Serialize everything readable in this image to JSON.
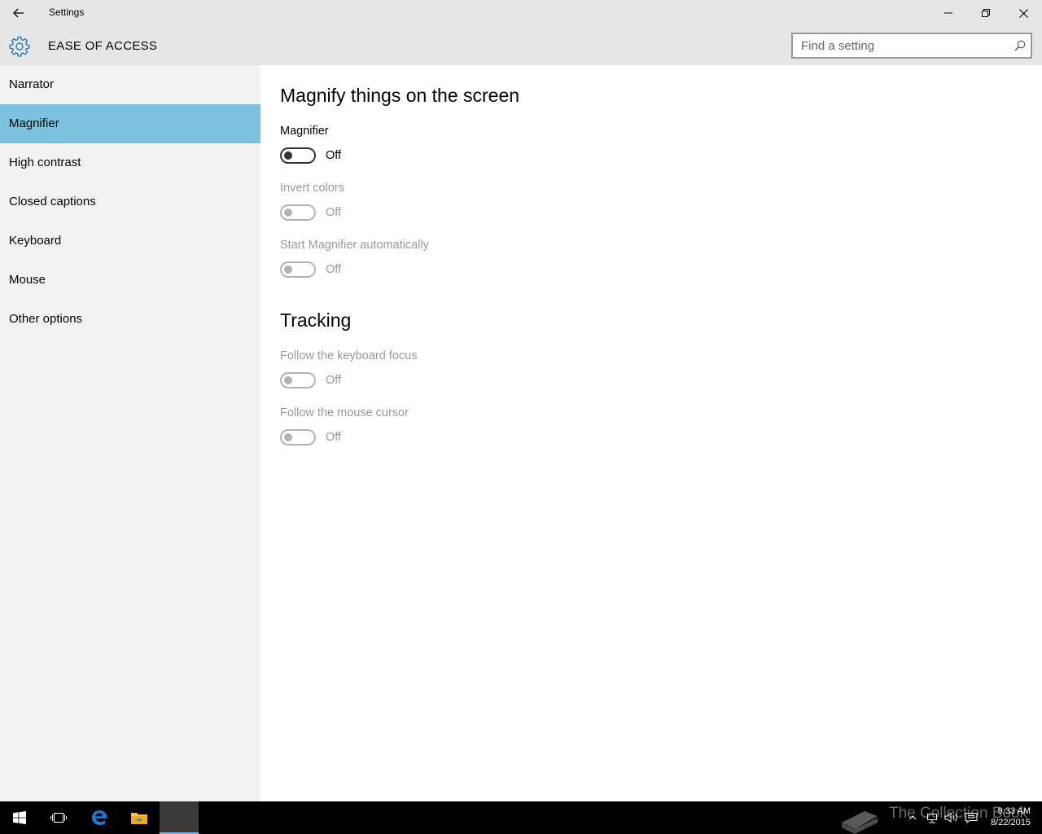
{
  "window": {
    "title": "Settings"
  },
  "header": {
    "section": "EASE OF ACCESS",
    "search_placeholder": "Find a setting"
  },
  "sidebar": {
    "items": [
      {
        "label": "Narrator"
      },
      {
        "label": "Magnifier",
        "active": true
      },
      {
        "label": "High contrast"
      },
      {
        "label": "Closed captions"
      },
      {
        "label": "Keyboard"
      },
      {
        "label": "Mouse"
      },
      {
        "label": "Other options"
      }
    ]
  },
  "main": {
    "heading": "Magnify things on the screen",
    "magnifier": {
      "label": "Magnifier",
      "state": "Off",
      "enabled": true
    },
    "invert": {
      "label": "Invert colors",
      "state": "Off",
      "enabled": false
    },
    "autostart": {
      "label": "Start Magnifier automatically",
      "state": "Off",
      "enabled": false
    },
    "tracking_heading": "Tracking",
    "keyboard_focus": {
      "label": "Follow the keyboard focus",
      "state": "Off",
      "enabled": false
    },
    "mouse_cursor": {
      "label": "Follow the mouse cursor",
      "state": "Off",
      "enabled": false
    }
  },
  "taskbar": {
    "clock_time": "9:33 AM",
    "clock_date": "8/22/2015",
    "watermark": "The Collection Book"
  },
  "colors": {
    "accent": "#7cc2dc",
    "gear": "#2d7dbd",
    "chrome": "#e6e6e6",
    "sidebar": "#f2f2f2"
  }
}
